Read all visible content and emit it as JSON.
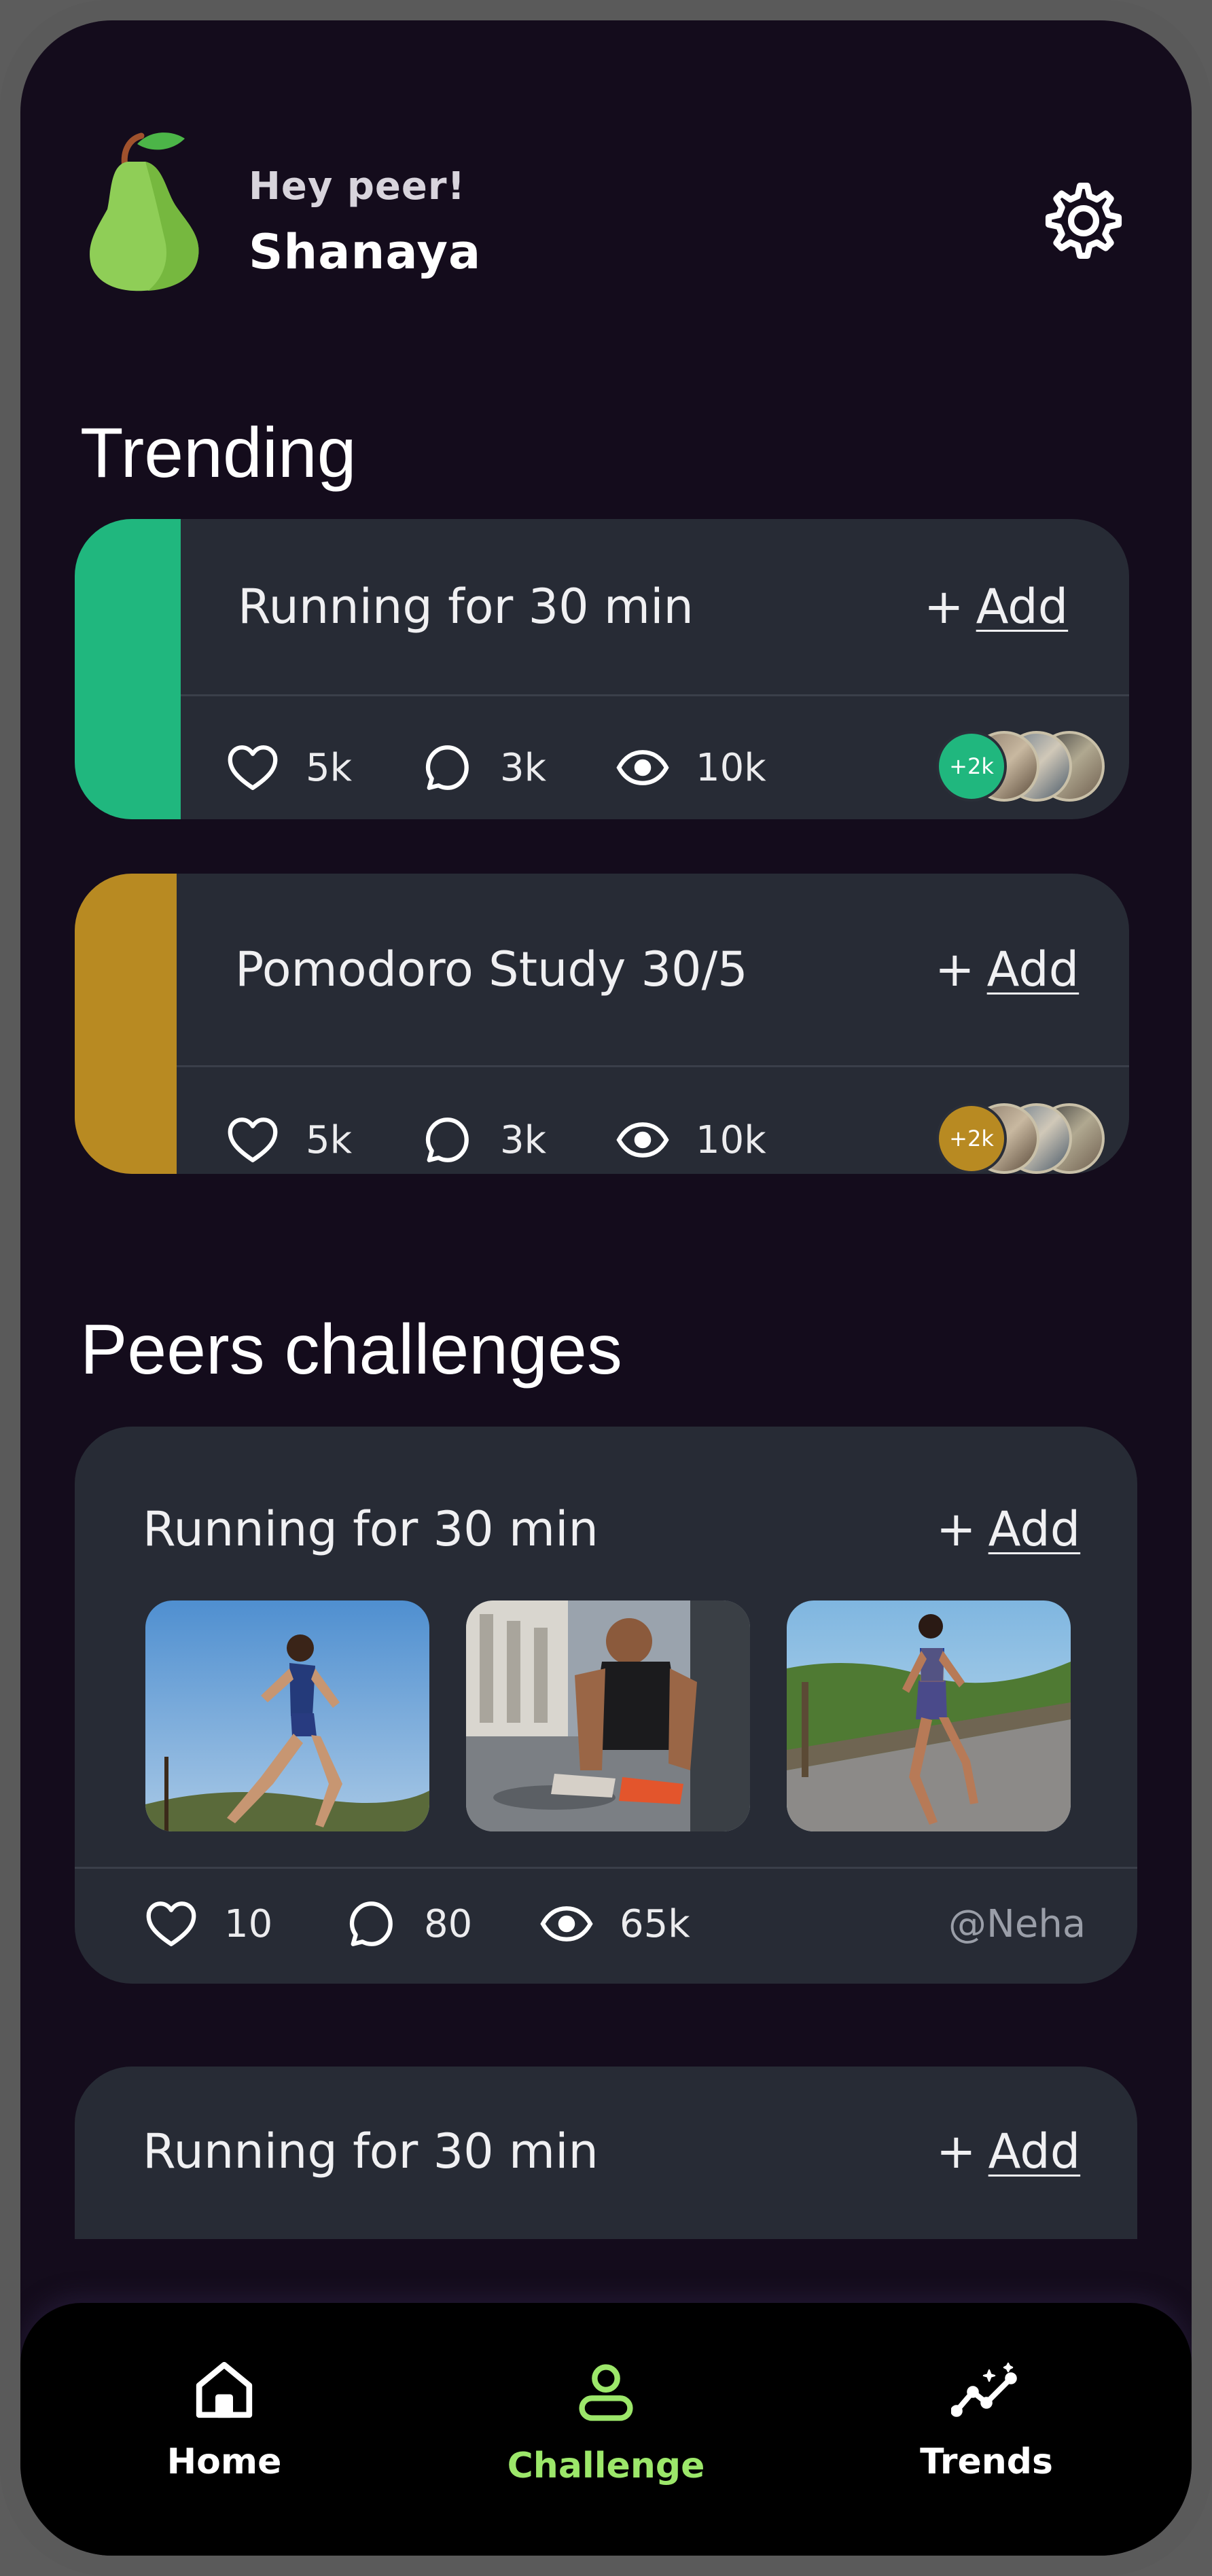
{
  "header": {
    "greeting": "Hey peer!",
    "username": "Shanaya"
  },
  "trending": {
    "title": "Trending",
    "cards": [
      {
        "title": "Running for 30 min",
        "add_plus": "+",
        "add_label": "Add",
        "likes": "5k",
        "comments": "3k",
        "views": "10k",
        "participants_badge": "+2k",
        "accent": "#20b77e"
      },
      {
        "title": "Pomodoro Study 30/5",
        "add_plus": "+",
        "add_label": "Add",
        "likes": "5k",
        "comments": "3k",
        "views": "10k",
        "participants_badge": "+2k",
        "accent": "#b88a22"
      }
    ]
  },
  "peers": {
    "title": "Peers challenges",
    "cards": [
      {
        "title": "Running for 30 min",
        "add_plus": "+",
        "add_label": "Add",
        "likes": "10",
        "comments": "80",
        "views": "65k",
        "handle": "@Neha",
        "photos": [
          "runner-sky-photo",
          "man-tying-shoe-photo",
          "woman-running-path-photo"
        ]
      },
      {
        "title": "Running for 30 min",
        "add_plus": "+",
        "add_label": "Add"
      }
    ]
  },
  "nav": {
    "items": [
      {
        "label": "Home",
        "icon": "home-icon",
        "active": false
      },
      {
        "label": "Challenge",
        "icon": "person-icon",
        "active": true
      },
      {
        "label": "Trends",
        "icon": "trends-icon",
        "active": false
      }
    ]
  },
  "colors": {
    "background": "#140c1c",
    "card": "#272b35",
    "active_nav": "#9ce76a",
    "green_accent": "#20b77e",
    "gold_accent": "#b88a22"
  }
}
